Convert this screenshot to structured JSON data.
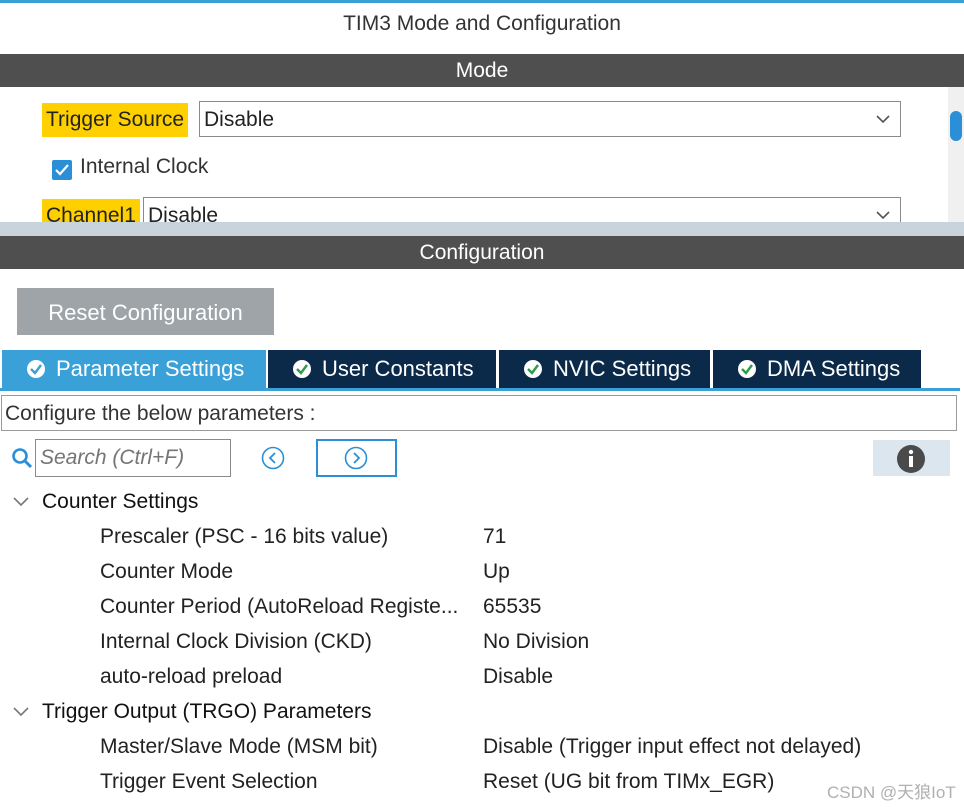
{
  "window": {
    "title": "TIM3 Mode and Configuration"
  },
  "mode_section": {
    "header": "Mode",
    "trigger_source": {
      "label": "Trigger Source",
      "value": "Disable"
    },
    "internal_clock": {
      "label": "Internal Clock",
      "checked": true
    },
    "channel1": {
      "label": "Channel1",
      "value": "Disable"
    }
  },
  "config_section": {
    "header": "Configuration",
    "reset_label": "Reset Configuration",
    "tabs": [
      {
        "label": "Parameter Settings",
        "active": true
      },
      {
        "label": "User Constants",
        "active": false
      },
      {
        "label": "NVIC Settings",
        "active": false
      },
      {
        "label": "DMA Settings",
        "active": false
      }
    ],
    "description": "Configure the below parameters :",
    "search": {
      "placeholder": "Search (Ctrl+F)"
    },
    "groups": [
      {
        "label": "Counter Settings",
        "items": [
          {
            "name": "Prescaler (PSC - 16 bits value)",
            "value": "71"
          },
          {
            "name": "Counter Mode",
            "value": "Up"
          },
          {
            "name": "Counter Period (AutoReload Registe...",
            "value": "65535"
          },
          {
            "name": "Internal Clock Division (CKD)",
            "value": "No Division"
          },
          {
            "name": "auto-reload preload",
            "value": "Disable"
          }
        ]
      },
      {
        "label": "Trigger Output (TRGO) Parameters",
        "items": [
          {
            "name": "Master/Slave Mode (MSM bit)",
            "value": "Disable (Trigger input effect not delayed)"
          },
          {
            "name": "Trigger Event Selection",
            "value": "Reset (UG bit from TIMx_EGR)"
          }
        ]
      }
    ]
  },
  "watermark": "CSDN @天狼IoT",
  "colors": {
    "accent": "#3aa0d8",
    "highlight": "#ffd000",
    "tab_dark": "#0b2a4a",
    "bar": "#4f4f4f"
  }
}
